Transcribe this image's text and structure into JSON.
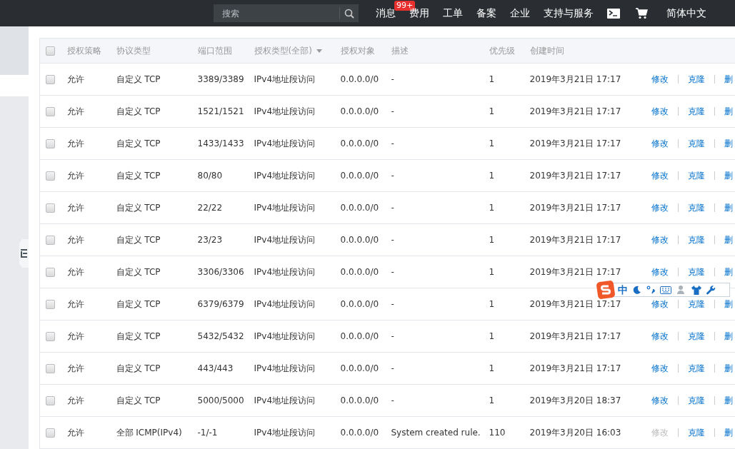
{
  "topbar": {
    "search": {
      "placeholder": "搜索"
    },
    "nav": [
      {
        "label": "消息",
        "badge": "99+"
      },
      {
        "label": "费用"
      },
      {
        "label": "工单"
      },
      {
        "label": "备案"
      },
      {
        "label": "企业"
      },
      {
        "label": "支持与服务"
      }
    ],
    "language": "简体中文"
  },
  "table": {
    "columns": [
      {
        "label": "授权策略"
      },
      {
        "label": "协议类型"
      },
      {
        "label": "端口范围"
      },
      {
        "label": "授权类型(全部)",
        "filter": true
      },
      {
        "label": "授权对象"
      },
      {
        "label": "描述"
      },
      {
        "label": "优先级"
      },
      {
        "label": "创建时间"
      }
    ],
    "rows": [
      {
        "checked": false,
        "policy": "允许",
        "protocol": "自定义 TCP",
        "port": "3389/3389",
        "auth_type": "IPv4地址段访问",
        "target": "0.0.0.0/0",
        "description": "-",
        "priority": "1",
        "created": "2019年3月21日 17:17",
        "actions": [
          {
            "label": "修改",
            "disabled": false
          },
          {
            "label": "克隆",
            "disabled": false
          },
          {
            "label": "删",
            "disabled": false
          }
        ]
      },
      {
        "checked": false,
        "policy": "允许",
        "protocol": "自定义 TCP",
        "port": "1521/1521",
        "auth_type": "IPv4地址段访问",
        "target": "0.0.0.0/0",
        "description": "-",
        "priority": "1",
        "created": "2019年3月21日 17:17",
        "actions": [
          {
            "label": "修改",
            "disabled": false
          },
          {
            "label": "克隆",
            "disabled": false
          },
          {
            "label": "删",
            "disabled": false
          }
        ]
      },
      {
        "checked": false,
        "policy": "允许",
        "protocol": "自定义 TCP",
        "port": "1433/1433",
        "auth_type": "IPv4地址段访问",
        "target": "0.0.0.0/0",
        "description": "-",
        "priority": "1",
        "created": "2019年3月21日 17:17",
        "actions": [
          {
            "label": "修改",
            "disabled": false
          },
          {
            "label": "克隆",
            "disabled": false
          },
          {
            "label": "删",
            "disabled": false
          }
        ]
      },
      {
        "checked": false,
        "policy": "允许",
        "protocol": "自定义 TCP",
        "port": "80/80",
        "auth_type": "IPv4地址段访问",
        "target": "0.0.0.0/0",
        "description": "-",
        "priority": "1",
        "created": "2019年3月21日 17:17",
        "actions": [
          {
            "label": "修改",
            "disabled": false
          },
          {
            "label": "克隆",
            "disabled": false
          },
          {
            "label": "删",
            "disabled": false
          }
        ]
      },
      {
        "checked": false,
        "policy": "允许",
        "protocol": "自定义 TCP",
        "port": "22/22",
        "auth_type": "IPv4地址段访问",
        "target": "0.0.0.0/0",
        "description": "-",
        "priority": "1",
        "created": "2019年3月21日 17:17",
        "actions": [
          {
            "label": "修改",
            "disabled": false
          },
          {
            "label": "克隆",
            "disabled": false
          },
          {
            "label": "删",
            "disabled": false
          }
        ]
      },
      {
        "checked": false,
        "policy": "允许",
        "protocol": "自定义 TCP",
        "port": "23/23",
        "auth_type": "IPv4地址段访问",
        "target": "0.0.0.0/0",
        "description": "-",
        "priority": "1",
        "created": "2019年3月21日 17:17",
        "actions": [
          {
            "label": "修改",
            "disabled": false
          },
          {
            "label": "克隆",
            "disabled": false
          },
          {
            "label": "删",
            "disabled": false
          }
        ]
      },
      {
        "checked": false,
        "policy": "允许",
        "protocol": "自定义 TCP",
        "port": "3306/3306",
        "auth_type": "IPv4地址段访问",
        "target": "0.0.0.0/0",
        "description": "-",
        "priority": "1",
        "created": "2019年3月21日 17:17",
        "actions": [
          {
            "label": "修改",
            "disabled": false
          },
          {
            "label": "克隆",
            "disabled": false
          },
          {
            "label": "删",
            "disabled": false
          }
        ]
      },
      {
        "checked": false,
        "policy": "允许",
        "protocol": "自定义 TCP",
        "port": "6379/6379",
        "auth_type": "IPv4地址段访问",
        "target": "0.0.0.0/0",
        "description": "-",
        "priority": "1",
        "created": "2019年3月21日 17:17",
        "actions": [
          {
            "label": "修改",
            "disabled": false
          },
          {
            "label": "克隆",
            "disabled": false
          },
          {
            "label": "删",
            "disabled": false
          }
        ]
      },
      {
        "checked": false,
        "policy": "允许",
        "protocol": "自定义 TCP",
        "port": "5432/5432",
        "auth_type": "IPv4地址段访问",
        "target": "0.0.0.0/0",
        "description": "-",
        "priority": "1",
        "created": "2019年3月21日 17:17",
        "actions": [
          {
            "label": "修改",
            "disabled": false
          },
          {
            "label": "克隆",
            "disabled": false
          },
          {
            "label": "删",
            "disabled": false
          }
        ]
      },
      {
        "checked": false,
        "policy": "允许",
        "protocol": "自定义 TCP",
        "port": "443/443",
        "auth_type": "IPv4地址段访问",
        "target": "0.0.0.0/0",
        "description": "-",
        "priority": "1",
        "created": "2019年3月21日 17:17",
        "actions": [
          {
            "label": "修改",
            "disabled": false
          },
          {
            "label": "克隆",
            "disabled": false
          },
          {
            "label": "删",
            "disabled": false
          }
        ]
      },
      {
        "checked": false,
        "policy": "允许",
        "protocol": "自定义 TCP",
        "port": "5000/5000",
        "auth_type": "IPv4地址段访问",
        "target": "0.0.0.0/0",
        "description": "-",
        "priority": "1",
        "created": "2019年3月20日 18:37",
        "actions": [
          {
            "label": "修改",
            "disabled": false
          },
          {
            "label": "克隆",
            "disabled": false
          },
          {
            "label": "删",
            "disabled": false
          }
        ]
      },
      {
        "checked": false,
        "policy": "允许",
        "protocol": "全部 ICMP(IPv4)",
        "port": "-1/-1",
        "auth_type": "IPv4地址段访问",
        "target": "0.0.0.0/0",
        "description": "System created rule.",
        "priority": "110",
        "created": "2019年3月20日 16:03",
        "actions": [
          {
            "label": "修改",
            "disabled": true
          },
          {
            "label": "克隆",
            "disabled": false
          },
          {
            "label": "删",
            "disabled": false
          }
        ]
      }
    ],
    "select_all": {
      "checked": false
    }
  },
  "ime_toolbar": {
    "mode": "中"
  }
}
